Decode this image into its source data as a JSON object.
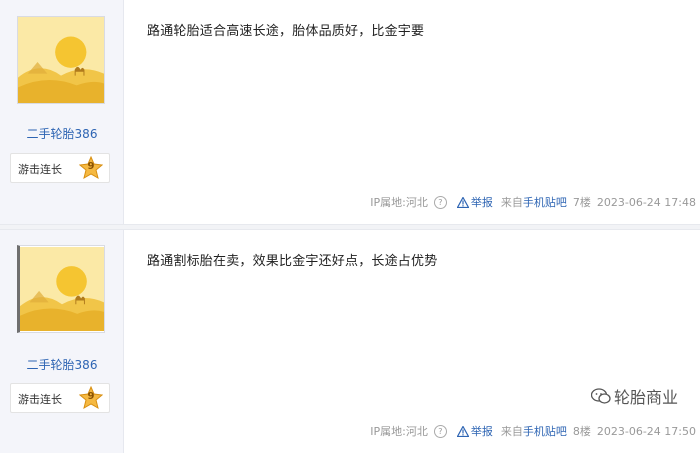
{
  "posts": [
    {
      "username": "二手轮胎386",
      "badge": {
        "label": "游击连长",
        "level": "9"
      },
      "content": "路通轮胎适合高速长途，胎体品质好，比金宇要",
      "meta": {
        "ip": "IP属地:河北",
        "report": "举报",
        "from_prefix": "来自",
        "from_link": "手机贴吧",
        "floor": "7楼",
        "time": "2023-06-24 17:48"
      }
    },
    {
      "username": "二手轮胎386",
      "badge": {
        "label": "游击连长",
        "level": "9"
      },
      "content": "路通割标胎在卖，效果比金宇还好点，长途占优势",
      "meta": {
        "ip": "IP属地:河北",
        "report": "举报",
        "from_prefix": "来自",
        "from_link": "手机贴吧",
        "floor": "8楼",
        "time": "2023-06-24 17:50"
      }
    }
  ],
  "watermark": {
    "text": "轮胎商业",
    "icon": "wechat-icon"
  },
  "colors": {
    "link": "#2d64b3",
    "sidebar_bg": "#f4f5fa",
    "meta_text": "#999999"
  }
}
